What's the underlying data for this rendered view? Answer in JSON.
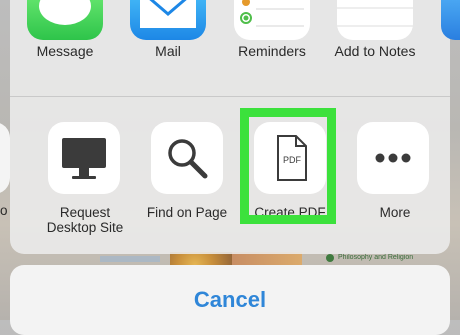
{
  "apps": [
    {
      "label": "Message",
      "icon": "message-icon"
    },
    {
      "label": "Mail",
      "icon": "mail-icon"
    },
    {
      "label": "Reminders",
      "icon": "reminders-icon"
    },
    {
      "label": "Add to Notes",
      "icon": "notes-icon"
    }
  ],
  "actions": [
    {
      "label_line1": "Request",
      "label_line2": "Desktop Site",
      "icon": "desktop-icon"
    },
    {
      "label": "Find on Page",
      "icon": "search-icon"
    },
    {
      "label": "Create PDF",
      "icon": "pdf-icon",
      "icon_text": "PDF",
      "highlighted": true
    },
    {
      "label": "More",
      "icon": "more-icon"
    }
  ],
  "partial_label": "o",
  "cancel_label": "Cancel",
  "background_text": "Philosophy and Religion",
  "colors": {
    "highlight": "#3ce13c",
    "cancel_text": "#2f86d8",
    "message_green": "#2ec44a",
    "mail_blue": "#1d87e6"
  }
}
